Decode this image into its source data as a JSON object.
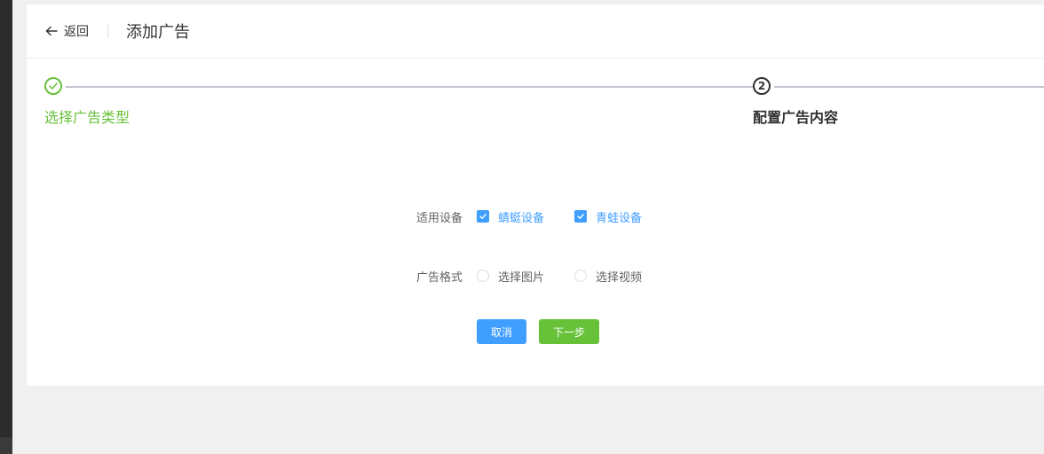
{
  "header": {
    "back_label": "返回",
    "title": "添加广告"
  },
  "steps": [
    {
      "number": "1",
      "title": "选择广告类型",
      "status": "finished"
    },
    {
      "number": "2",
      "title": "配置广告内容",
      "status": "active"
    }
  ],
  "form": {
    "devices": {
      "label": "适用设备",
      "options": [
        {
          "label": "蜻蜓设备",
          "checked": true
        },
        {
          "label": "青蛙设备",
          "checked": true
        }
      ]
    },
    "format": {
      "label": "广告格式",
      "options": [
        {
          "label": "选择图片",
          "selected": false
        },
        {
          "label": "选择视频",
          "selected": false
        }
      ]
    }
  },
  "buttons": {
    "cancel": "取消",
    "next": "下一步"
  },
  "colors": {
    "primary": "#409eff",
    "success": "#67c23a",
    "text": "#303133"
  }
}
